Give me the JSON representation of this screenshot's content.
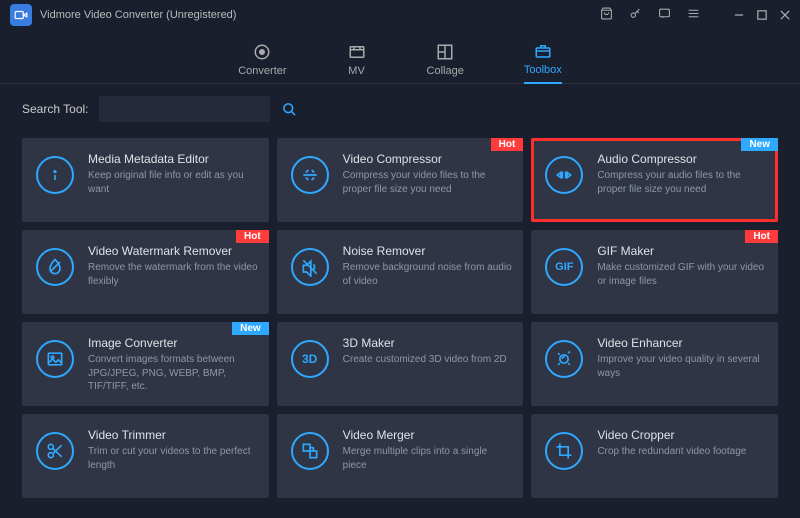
{
  "app": {
    "title": "Vidmore Video Converter (Unregistered)"
  },
  "nav": {
    "converter": "Converter",
    "mv": "MV",
    "collage": "Collage",
    "toolbox": "Toolbox"
  },
  "search": {
    "label": "Search Tool:"
  },
  "badges": {
    "hot": "Hot",
    "new": "New"
  },
  "tools": {
    "media_metadata": {
      "title": "Media Metadata Editor",
      "desc": "Keep original file info or edit as you want"
    },
    "video_compressor": {
      "title": "Video Compressor",
      "desc": "Compress your video files to the proper file size you need"
    },
    "audio_compressor": {
      "title": "Audio Compressor",
      "desc": "Compress your audio files to the proper file size you need"
    },
    "watermark_remover": {
      "title": "Video Watermark Remover",
      "desc": "Remove the watermark from the video flexibly"
    },
    "noise_remover": {
      "title": "Noise Remover",
      "desc": "Remove background noise from audio of video"
    },
    "gif_maker": {
      "title": "GIF Maker",
      "desc": "Make customized GIF with your video or image files"
    },
    "image_converter": {
      "title": "Image Converter",
      "desc": "Convert images formats between JPG/JPEG, PNG, WEBP, BMP, TIF/TIFF, etc."
    },
    "three_d_maker": {
      "title": "3D Maker",
      "desc": "Create customized 3D video from 2D"
    },
    "video_enhancer": {
      "title": "Video Enhancer",
      "desc": "Improve your video quality in several ways"
    },
    "video_trimmer": {
      "title": "Video Trimmer",
      "desc": "Trim or cut your videos to the perfect length"
    },
    "video_merger": {
      "title": "Video Merger",
      "desc": "Merge multiple clips into a single piece"
    },
    "video_cropper": {
      "title": "Video Cropper",
      "desc": "Crop the redundant video footage"
    }
  }
}
